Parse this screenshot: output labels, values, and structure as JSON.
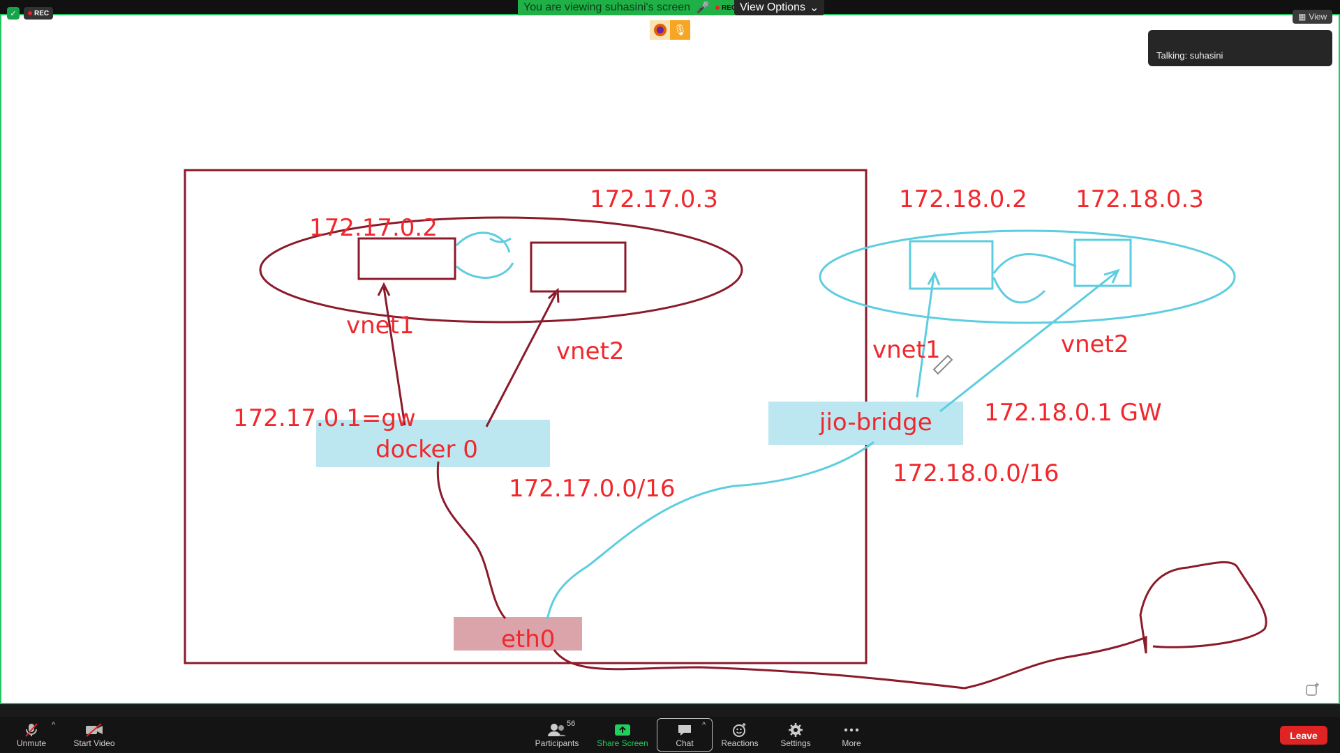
{
  "meeting": {
    "recording_label": "REC",
    "banner_text": "You are viewing suhasini's screen",
    "banner_rec": "REC",
    "view_options": "View Options",
    "view_button": "View",
    "talking_label": "Talking: suhasini"
  },
  "diagram": {
    "left": {
      "ip_container1": "172.17.0.2",
      "ip_container2": "172.17.0.3",
      "vnet1": "vnet1",
      "vnet2": "vnet2",
      "gateway": "172.17.0.1=gw",
      "bridge": "docker 0",
      "subnet": "172.17.0.0/16"
    },
    "right": {
      "ip_container1": "172.18.0.2",
      "ip_container2": "172.18.0.3",
      "vnet1": "vnet1",
      "vnet2": "vnet2",
      "gateway": "172.18.0.1 GW",
      "bridge": "jio-bridge",
      "subnet": "172.18.0.0/16"
    },
    "host_interface": "eth0",
    "colors": {
      "red": "#f0282d",
      "maroon": "#8b1a2b",
      "cyan": "#5dcde0",
      "blue_fill": "#bce6f0",
      "pink_fill": "#dba4aa"
    }
  },
  "toolbar": {
    "unmute": "Unmute",
    "start_video": "Start Video",
    "participants": "Participants",
    "participants_count": "56",
    "share_screen": "Share Screen",
    "chat": "Chat",
    "reactions": "Reactions",
    "settings": "Settings",
    "more": "More",
    "leave": "Leave"
  },
  "icons": [
    "shield-icon",
    "firefox-icon",
    "mic-icon",
    "grid-icon",
    "mic-muted-icon",
    "video-off-icon",
    "participants-icon",
    "share-screen-icon",
    "chat-icon",
    "reactions-icon",
    "gear-icon",
    "more-icon",
    "new-share-icon"
  ]
}
